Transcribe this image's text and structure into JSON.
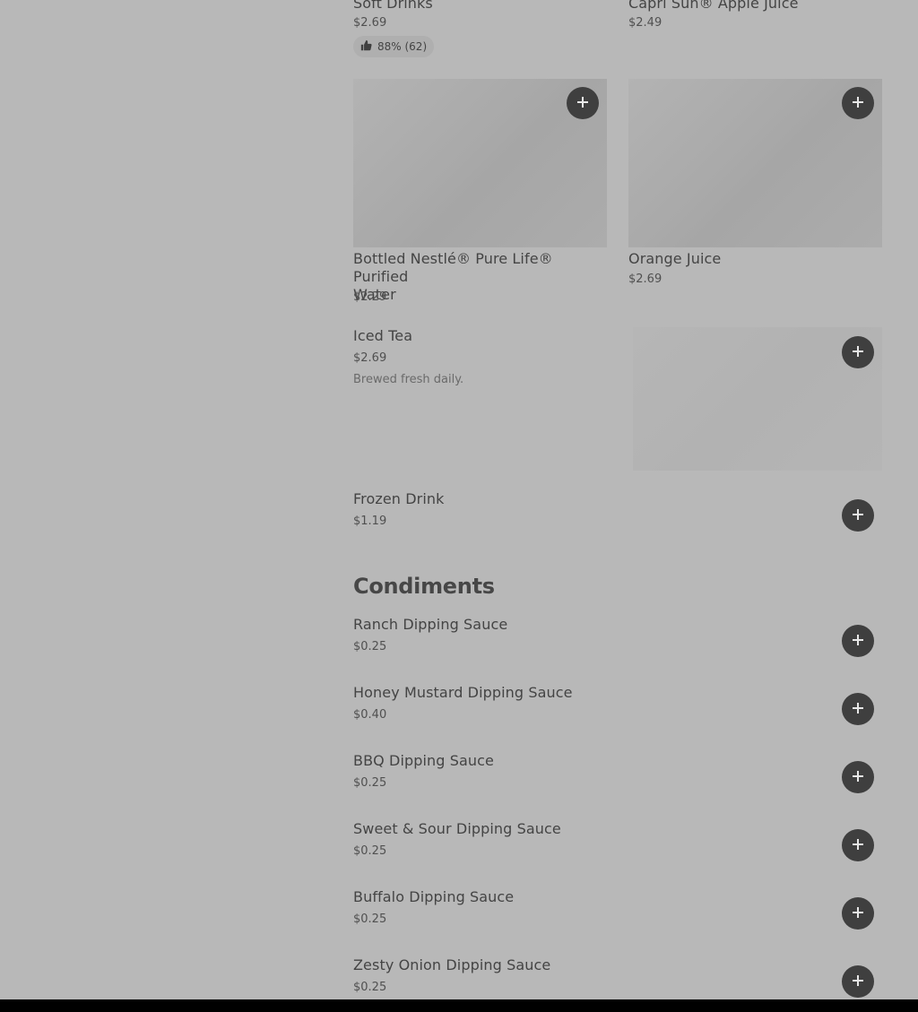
{
  "drinks": {
    "soft_drinks": {
      "name": "Soft Drinks",
      "price": "$2.69",
      "rating": "88% (62)"
    },
    "capri_sun": {
      "name": "Capri Sun® Apple Juice",
      "price": "$2.49"
    },
    "water": {
      "name_line1": "Bottled Nestlé® Pure Life® Purified",
      "name_line2": "Water",
      "price": "$2.29"
    },
    "orange_juice": {
      "name": "Orange Juice",
      "price": "$2.69"
    },
    "iced_tea": {
      "name": "Iced Tea",
      "price": "$2.69",
      "description": "Brewed fresh daily."
    },
    "frozen_drink": {
      "name": "Frozen Drink",
      "price": "$1.19"
    }
  },
  "condiments": {
    "title": "Condiments",
    "items": [
      {
        "name": "Ranch Dipping Sauce",
        "price": "$0.25"
      },
      {
        "name": "Honey Mustard Dipping Sauce",
        "price": "$0.40"
      },
      {
        "name": "BBQ Dipping Sauce",
        "price": "$0.25"
      },
      {
        "name": "Sweet & Sour Dipping Sauce",
        "price": "$0.25"
      },
      {
        "name": "Buffalo Dipping Sauce",
        "price": "$0.25"
      },
      {
        "name": "Zesty Onion Dipping Sauce",
        "price": "$0.25"
      }
    ]
  },
  "icons": {
    "add": "plus-icon",
    "rating": "thumbs-up-icon"
  },
  "colors": {
    "background": "#b8b8b8",
    "button": "#3f3f3f",
    "text": "#444444"
  }
}
